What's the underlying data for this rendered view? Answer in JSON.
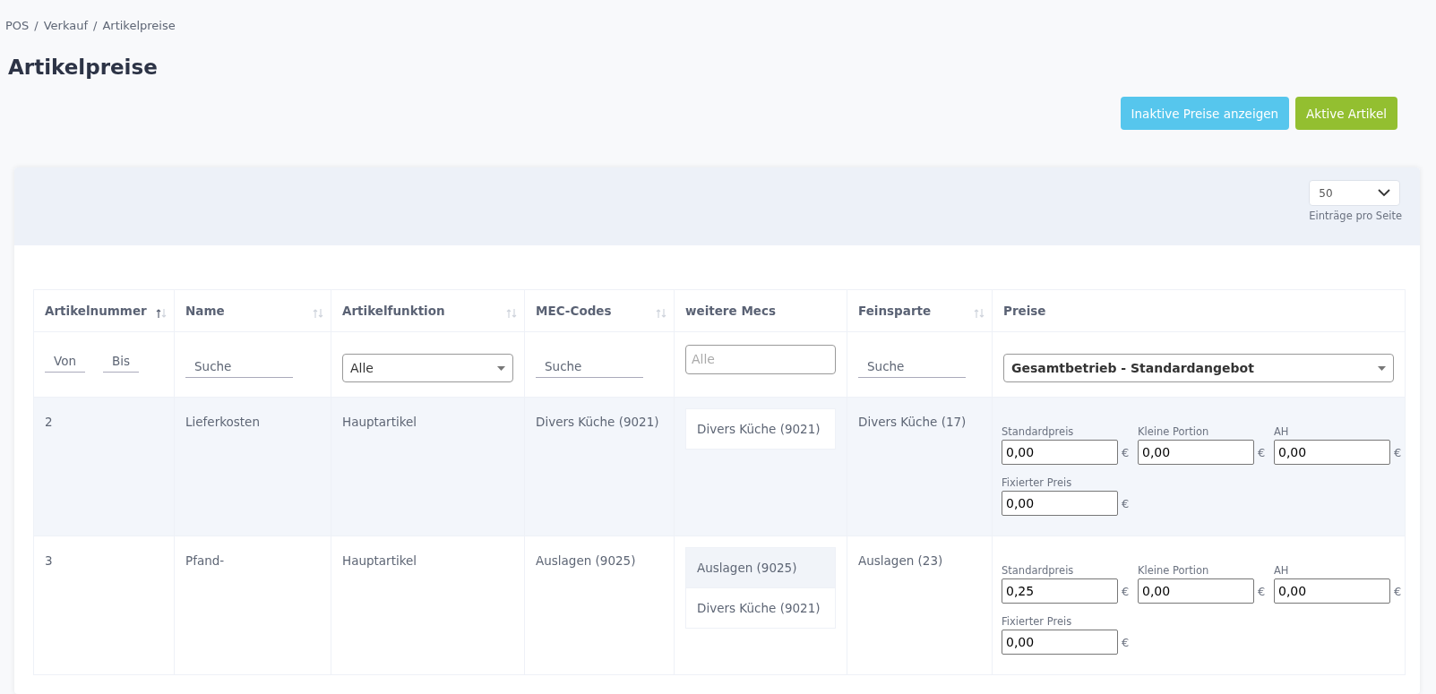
{
  "breadcrumb": {
    "separator": "/",
    "items": [
      "POS",
      "Verkauf",
      "Artikelpreise"
    ]
  },
  "title": "Artikelpreise",
  "actions": [
    {
      "label": "Inaktive Preise anzeigen",
      "kind": "info"
    },
    {
      "label": "Aktive Artikel",
      "kind": "success"
    }
  ],
  "page_size": {
    "value": "50",
    "caption": "Einträge pro Seite"
  },
  "table": {
    "columns": [
      {
        "label": "Artikelnummer",
        "sortable": true,
        "sorted": true
      },
      {
        "label": "Name",
        "sortable": true,
        "sorted": false
      },
      {
        "label": "Artikelfunktion",
        "sortable": true,
        "sorted": false
      },
      {
        "label": "MEC-Codes",
        "sortable": true,
        "sorted": false
      },
      {
        "label": "weitere Mecs"
      },
      {
        "label": "Feinsparte",
        "sortable": true,
        "sorted": false
      },
      {
        "label": "Preise"
      }
    ],
    "filters": [
      {
        "kind": "range",
        "from": "Von",
        "to": "Bis"
      },
      {
        "kind": "text",
        "placeholder": "Suche"
      },
      {
        "kind": "select",
        "value": "Alle"
      },
      {
        "kind": "text",
        "placeholder": "Suche"
      },
      {
        "kind": "tags",
        "placeholder": "Alle"
      },
      {
        "kind": "text",
        "placeholder": "Suche"
      },
      {
        "kind": "select",
        "value": "Gesamtbetrieb - Standardangebot",
        "bold": true
      }
    ],
    "rows": [
      {
        "highlighted": true,
        "number": "2",
        "name": "Lieferkosten",
        "function": "Hauptartikel",
        "mec_code": "Divers Küche (9021)",
        "more_mecs": [
          {
            "label": "Divers Küche (9021)",
            "shaded": false
          }
        ],
        "feinsparte": "Divers Küche (17)",
        "prices": [
          {
            "label": "Standardpreis",
            "value": "0,00",
            "currency": "€"
          },
          {
            "label": "Kleine Portion",
            "value": "0,00",
            "currency": "€"
          },
          {
            "label": "AH",
            "value": "0,00",
            "currency": "€"
          },
          {
            "label": "Fixierter Preis",
            "value": "0,00",
            "currency": "€"
          }
        ]
      },
      {
        "highlighted": false,
        "number": "3",
        "name": "Pfand-",
        "function": "Hauptartikel",
        "mec_code": "Auslagen (9025)",
        "more_mecs": [
          {
            "label": "Auslagen (9025)",
            "shaded": true
          },
          {
            "label": "Divers Küche (9021)",
            "shaded": false
          }
        ],
        "feinsparte": "Auslagen (23)",
        "prices": [
          {
            "label": "Standardpreis",
            "value": "0,25",
            "currency": "€"
          },
          {
            "label": "Kleine Portion",
            "value": "0,00",
            "currency": "€"
          },
          {
            "label": "AH",
            "value": "0,00",
            "currency": "€"
          },
          {
            "label": "Fixierter Preis",
            "value": "0,00",
            "currency": "€"
          }
        ]
      }
    ]
  }
}
